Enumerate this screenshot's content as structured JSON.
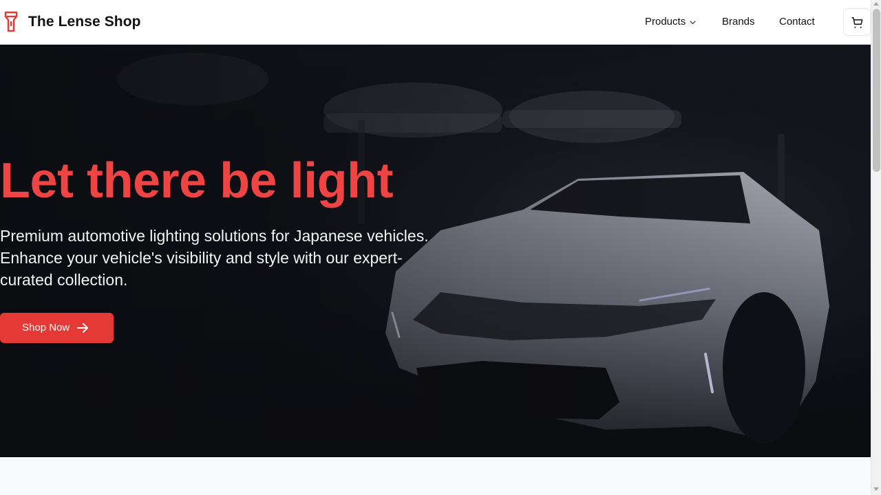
{
  "header": {
    "brand": "The Lense Shop",
    "logo_icon": "flashlight-icon",
    "nav": [
      {
        "label": "Products",
        "icon": "chevron-down-icon"
      },
      {
        "label": "Brands"
      },
      {
        "label": "Contact"
      }
    ],
    "cart_icon": "shopping-cart-icon"
  },
  "hero": {
    "headline": "Let there be light",
    "subtitle": "Premium automotive lighting solutions for Japanese vehicles. Enhance your vehicle's visibility and style with our expert-curated collection.",
    "cta_label": "Shop Now",
    "cta_icon": "arrow-right-icon",
    "background_image": "dark-garage-sports-car-photo"
  },
  "colors": {
    "accent": "#ef4444",
    "button": "#e53935",
    "hero_bg": "#0f1117",
    "text_dark": "#111111"
  }
}
